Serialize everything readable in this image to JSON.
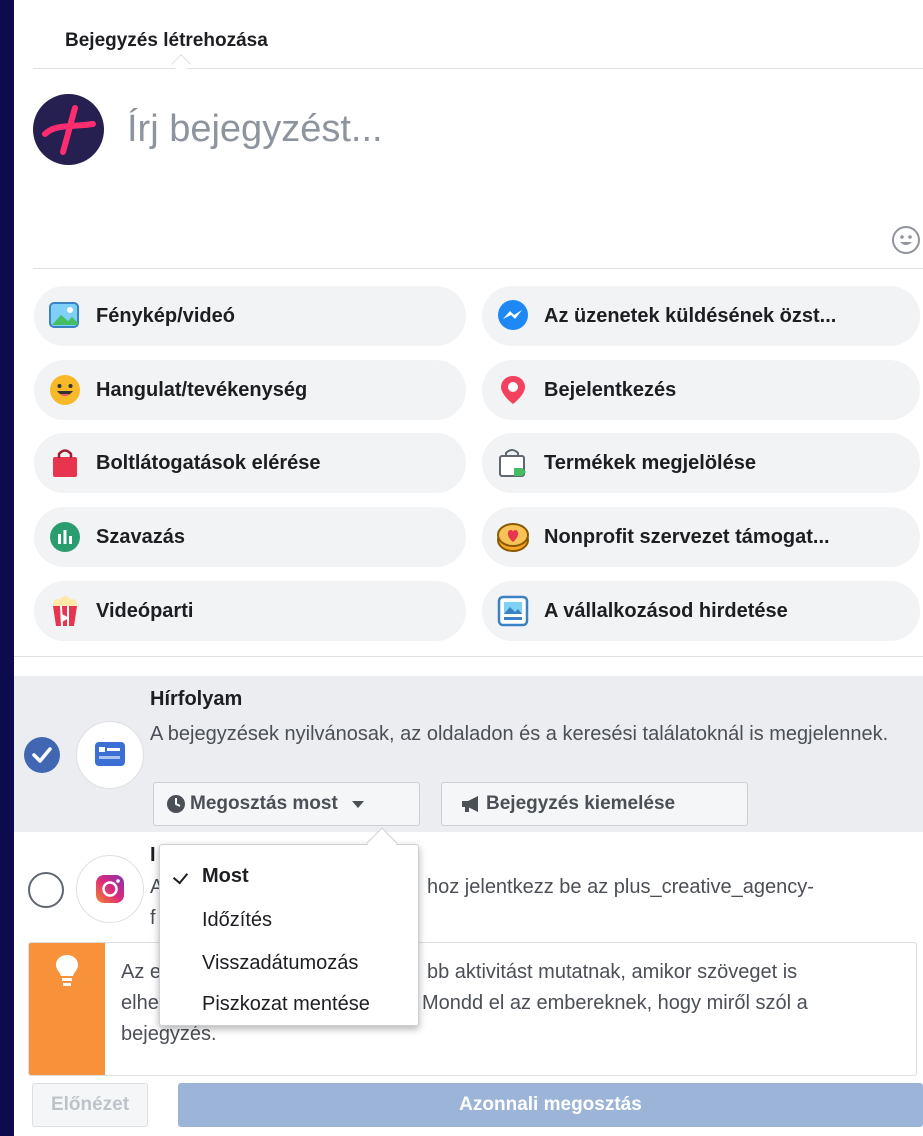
{
  "composer": {
    "title": "Bejegyzés létrehozása",
    "placeholder": "Írj bejegyzést..."
  },
  "options": [
    {
      "label": "Fénykép/videó",
      "icon": "photo-video-icon"
    },
    {
      "label": "Az üzenetek küldésének özst...",
      "icon": "messenger-icon"
    },
    {
      "label": "Hangulat/tevékenység",
      "icon": "smiley-icon"
    },
    {
      "label": "Bejelentkezés",
      "icon": "location-pin-icon"
    },
    {
      "label": "Boltlátogatások elérése",
      "icon": "shopping-bag-icon"
    },
    {
      "label": "Termékek megjelölése",
      "icon": "product-tag-icon"
    },
    {
      "label": "Szavazás",
      "icon": "poll-icon"
    },
    {
      "label": "Nonprofit szervezet támogat...",
      "icon": "heart-coin-icon"
    },
    {
      "label": "Videóparti",
      "icon": "popcorn-icon"
    },
    {
      "label": "A vállalkozásod hirdetése",
      "icon": "advertise-icon"
    }
  ],
  "feed": {
    "title": "Hírfolyam",
    "description": "A bejegyzések nyilvánosak, az oldaladon és a keresési találatoknál is megjelennek.",
    "share_now_label": "Megosztás most",
    "boost_label": "Bejegyzés kiemelése"
  },
  "instagram": {
    "title_visible": "I",
    "desc_part1": "A",
    "desc_part2": "hoz jelentkezz be az plus_creative_agency-",
    "desc_part3": "f"
  },
  "tip": {
    "line1_a": "Az e",
    "line1_b": "bb aktivitást mutatnak, amikor szöveget is",
    "line2_a": "elhe",
    "line2_b": "Mondd el az embereknek, hogy miről szól a",
    "line3": "bejegyzés."
  },
  "dropdown": {
    "items": [
      "Most",
      "Időzítés",
      "Visszadátumozás",
      "Piszkozat mentése"
    ],
    "selected": "Most"
  },
  "footer": {
    "preview_label": "Előnézet",
    "share_label": "Azonnali megosztás"
  },
  "colors": {
    "background": "#0b0b4d",
    "accent": "#4267b2",
    "tip": "#f7923a",
    "share_disabled": "#9cb4d8"
  }
}
